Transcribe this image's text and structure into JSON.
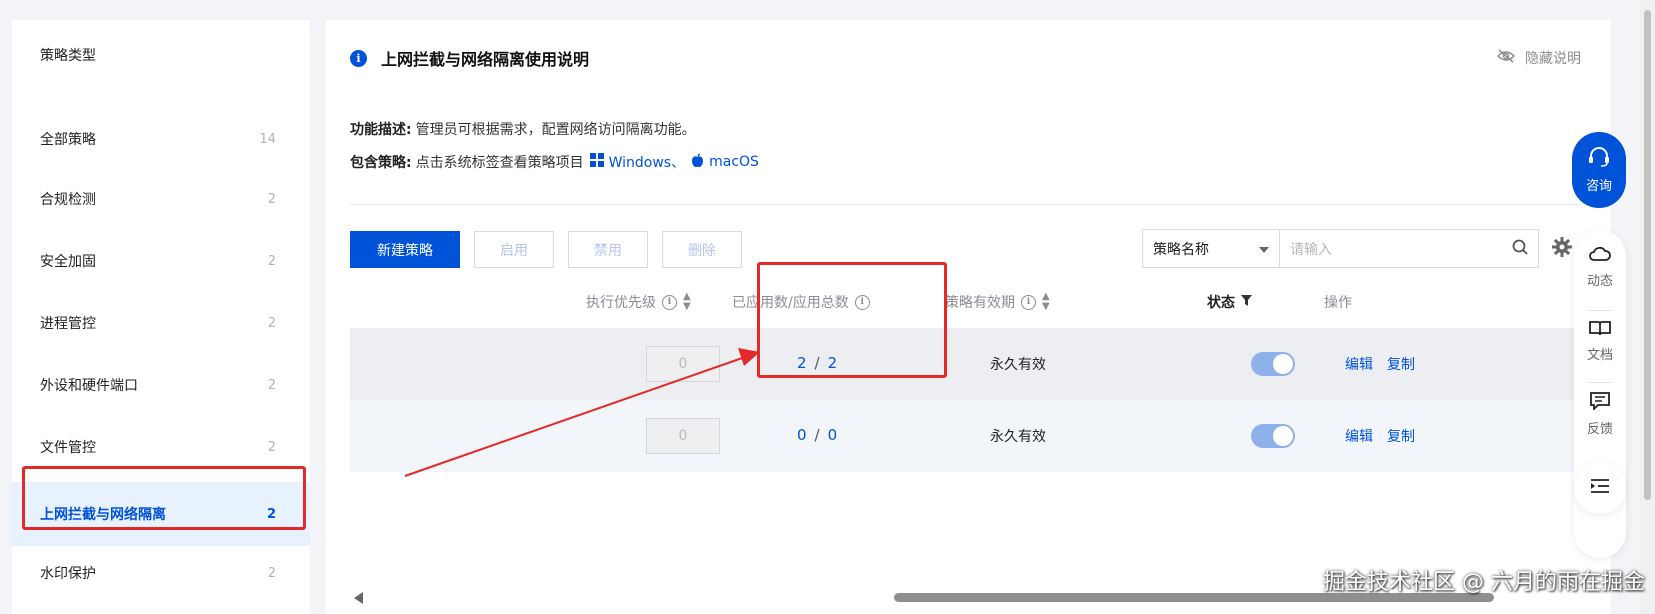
{
  "sidebar": {
    "heading": "策略类型",
    "items": [
      {
        "label": "全部策略",
        "count": "14"
      },
      {
        "label": "合规检测",
        "count": "2"
      },
      {
        "label": "安全加固",
        "count": "2"
      },
      {
        "label": "进程管控",
        "count": "2"
      },
      {
        "label": "外设和硬件端口",
        "count": "2"
      },
      {
        "label": "文件管控",
        "count": "2"
      },
      {
        "label": "上网拦截与网络隔离",
        "count": "2"
      },
      {
        "label": "水印保护",
        "count": "2"
      }
    ],
    "active_index": 6
  },
  "info": {
    "title": "上网拦截与网络隔离使用说明",
    "hide_label": "隐藏说明",
    "desc_label": "功能描述:",
    "desc_text": "管理员可根据需求，配置网络访问隔离功能。",
    "policy_label": "包含策略:",
    "policy_text": "点击系统标签查看策略项目",
    "os_windows": "Windows、",
    "os_macos": "macOS"
  },
  "toolbar": {
    "new_label": "新建策略",
    "enable_label": "启用",
    "disable_label": "禁用",
    "delete_label": "删除",
    "filter_selected": "策略名称",
    "search_placeholder": "请输入"
  },
  "table": {
    "columns": {
      "priority": "执行优先级",
      "applied": "已应用数/应用总数",
      "validity": "策略有效期",
      "status": "状态",
      "actions": "操作"
    },
    "rows": [
      {
        "priority": "0",
        "applied": "2",
        "total": "2",
        "validity": "永久有效",
        "status_on": true,
        "edit": "编辑",
        "copy": "复制"
      },
      {
        "priority": "0",
        "applied": "0",
        "total": "0",
        "validity": "永久有效",
        "status_on": true,
        "edit": "编辑",
        "copy": "复制"
      }
    ],
    "separator": "/"
  },
  "float": {
    "consult": "咨询",
    "dynamic": "动态",
    "docs": "文档",
    "feedback": "反馈"
  },
  "watermark": "掘金技术社区 @ 六月的雨在掘金",
  "colors": {
    "accent": "#0052d9",
    "highlight_red": "#e52828"
  }
}
